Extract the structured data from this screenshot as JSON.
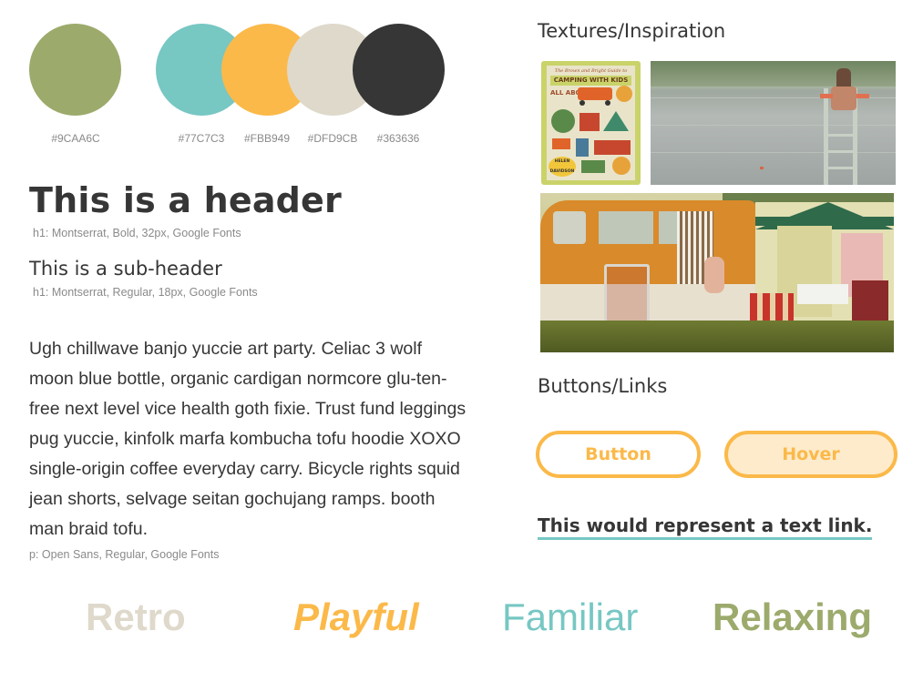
{
  "palette": [
    {
      "hex": "#9CAA6C",
      "color": "#9CAA6C"
    },
    {
      "hex": "#77C7C3",
      "color": "#77C7C3"
    },
    {
      "hex": "#FBB949",
      "color": "#FBB949"
    },
    {
      "hex": "#DFD9CB",
      "color": "#DFD9CB"
    },
    {
      "hex": "#363636",
      "color": "#363636"
    }
  ],
  "typography": {
    "header": "This is a header",
    "header_note": "h1: Montserrat, Bold, 32px, Google Fonts",
    "subheader": "This is a sub-header",
    "subheader_note": "h1: Montserrat, Regular, 18px, Google Fonts",
    "paragraph": "Ugh chillwave banjo yuccie art party. Celiac 3 wolf moon blue bottle, organic cardigan normcore glu-ten-free next level vice health goth fixie. Trust fund leggings pug yuccie, kinfolk marfa kombucha tofu hoodie XOXO single-origin coffee everyday carry. Bicycle rights squid jean shorts, selvage seitan gochujang ramps. booth man braid tofu.",
    "paragraph_note": "p: Open Sans, Regular, Google Fonts"
  },
  "textures": {
    "title": "Textures/Inspiration",
    "book_title": "CAMPING WITH KIDS",
    "book_top": "The Brown and Bright Guide to",
    "book_subtitle": "ALL ABOUT",
    "book_author": "HELEN DAVIDSON"
  },
  "buttons": {
    "title": "Buttons/Links",
    "button_label": "Button",
    "hover_label": "Hover",
    "link_text": "This would represent a text link."
  },
  "moods": [
    {
      "label": "Retro",
      "color": "#DFD9CB"
    },
    {
      "label": "Playful",
      "color": "#FBB949"
    },
    {
      "label": "Familiar",
      "color": "#77C7C3"
    },
    {
      "label": "Relaxing",
      "color": "#9CAA6C"
    }
  ]
}
